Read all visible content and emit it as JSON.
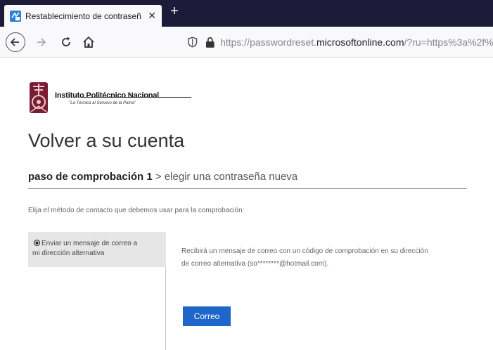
{
  "browser": {
    "tab_title": "Restablecimiento de contraseñ",
    "tab_close": "✕",
    "new_tab": "+",
    "url_domain_prefix": "https://passwordreset.",
    "url_domain": "microsoftonline.com",
    "url_rest": "/?ru=https%3a%2f%2f",
    "icons": {
      "back": "back-arrow-icon",
      "forward": "forward-arrow-icon",
      "reload": "reload-icon",
      "home": "home-icon",
      "shield": "shield-icon",
      "lock": "lock-icon"
    }
  },
  "logo": {
    "name": "Instituto Politécnico Nacional",
    "slogan": "\"La Técnica al Servicio de la Patria\""
  },
  "page": {
    "title": "Volver a su cuenta",
    "step_current": "paso de comprobación 1",
    "step_separator": " > ",
    "step_next": "elegir una contraseña nueva",
    "instruction": "Elija el método de contacto que debemos usar para la comprobación:"
  },
  "method": {
    "option_label_line1": "Enviar un mensaje de correo a",
    "option_label_line2": "mi dirección alternativa",
    "detail_line1": "Recibirá un mensaje de correo con un código de comprobación en su dirección",
    "detail_line2": "de correo alternativa (so********@hotmail.com).",
    "button_label": "Correo"
  },
  "colors": {
    "tabbar_bg": "#1c1b3a",
    "button_blue": "#1e66c8",
    "selected_option_bg": "#e6e6e6"
  }
}
